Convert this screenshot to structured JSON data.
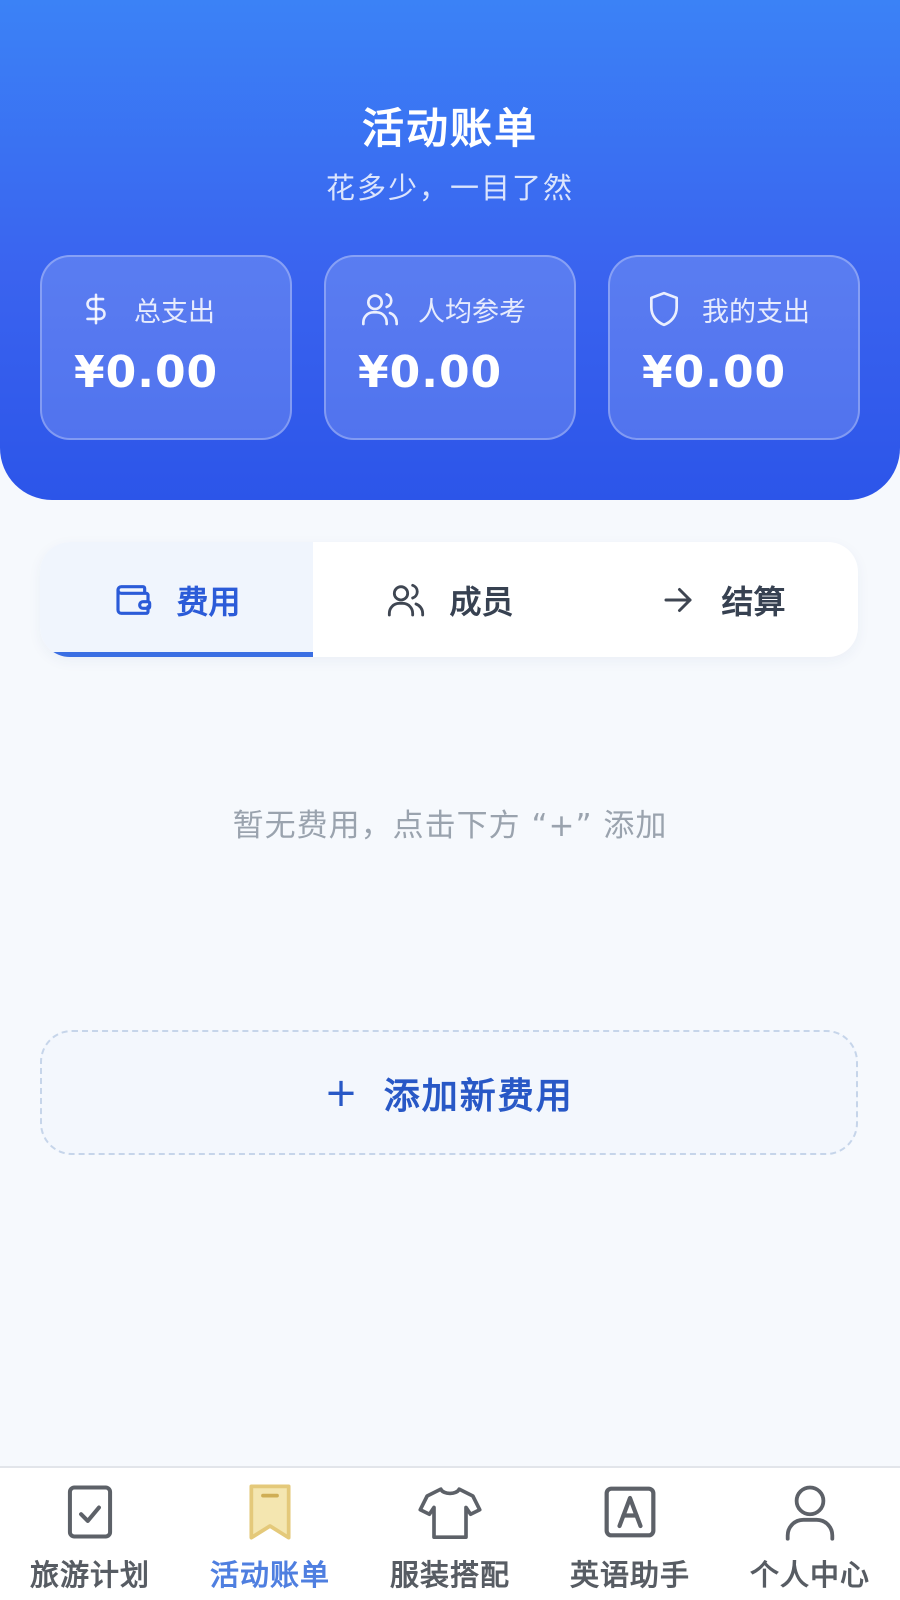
{
  "header": {
    "title": "活动账单",
    "subtitle": "花多少，一目了然"
  },
  "stats": [
    {
      "label": "总支出",
      "value": "¥0.00",
      "icon": "dollar-icon"
    },
    {
      "label": "人均参考",
      "value": "¥0.00",
      "icon": "users-icon"
    },
    {
      "label": "我的支出",
      "value": "¥0.00",
      "icon": "shield-icon"
    }
  ],
  "tabs": [
    {
      "label": "费用",
      "icon": "wallet-icon",
      "active": true
    },
    {
      "label": "成员",
      "icon": "users-icon",
      "active": false
    },
    {
      "label": "结算",
      "icon": "arrow-right-icon",
      "active": false
    }
  ],
  "empty_state": "暂无费用，点击下方 “+” 添加",
  "add_button": {
    "plus": "+",
    "label": "添加新费用"
  },
  "bottom_nav": [
    {
      "label": "旅游计划",
      "icon": "checklist-icon",
      "active": false
    },
    {
      "label": "活动账单",
      "icon": "bookmark-icon",
      "active": true
    },
    {
      "label": "服装搭配",
      "icon": "tshirt-icon",
      "active": false
    },
    {
      "label": "英语助手",
      "icon": "letter-a-icon",
      "active": false
    },
    {
      "label": "个人中心",
      "icon": "user-icon",
      "active": false
    }
  ],
  "colors": {
    "header_gradient_top": "#3b82f6",
    "header_gradient_bottom": "#2c55e9",
    "accent": "#2b5bd8",
    "nav_active": "#4f7fe0",
    "bookmark_icon_fill": "#f4e6b0"
  }
}
